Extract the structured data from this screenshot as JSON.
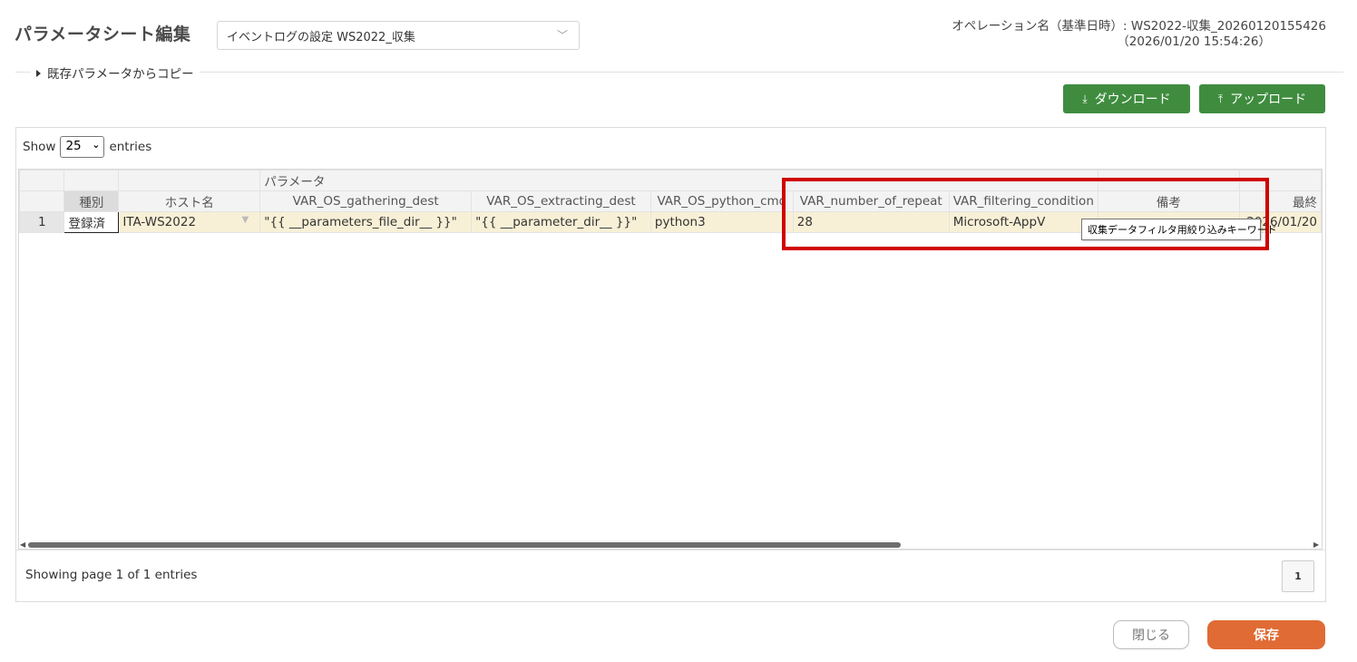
{
  "header": {
    "title": "パラメータシート編集",
    "sheet_select": {
      "value": "イベントログの設定 WS2022_収集"
    },
    "operation_label": "オペレーション名（基準日時）:",
    "operation_name": "WS2022-収集_20260120155426",
    "operation_date": "（2026/01/20 15:54:26）"
  },
  "copy_section": {
    "label": "既存パラメータからコピー"
  },
  "toolbar": {
    "download_label": "ダウンロード",
    "upload_label": "アップロード"
  },
  "grid": {
    "show_label": "Show",
    "entries_value": "25",
    "entries_label": "entries",
    "group_header": "パラメータ",
    "columns": {
      "kind": "種別",
      "host": "ホスト名",
      "gathering_dest": "VAR_OS_gathering_dest",
      "extracting_dest": "VAR_OS_extracting_dest",
      "python_cmd": "VAR_OS_python_cmd",
      "number_of_repeat": "VAR_number_of_repeat",
      "filtering_condition": "VAR_filtering_condition",
      "remarks": "備考",
      "last_updated": "最終"
    },
    "rows": [
      {
        "no": "1",
        "kind": "登録済",
        "host": "ITA-WS2022",
        "gathering_dest": "\"{{ __parameters_file_dir__ }}\"",
        "extracting_dest": "\"{{ __parameter_dir__ }}\"",
        "python_cmd": "python3",
        "number_of_repeat": "28",
        "filtering_condition": "Microsoft-AppV",
        "remarks": "",
        "last_updated": "2026/01/20"
      }
    ],
    "footer_text": "Showing page 1 of 1 entries",
    "page_number": "1"
  },
  "tooltip": "収集データフィルタ用絞り込みキーワード",
  "actions": {
    "close_label": "閉じる",
    "save_label": "保存"
  },
  "colors": {
    "green_button": "#3f8c3f",
    "save_button": "#e06b35",
    "highlight_border": "#d00000",
    "data_row_bg": "#f8f0d6"
  }
}
